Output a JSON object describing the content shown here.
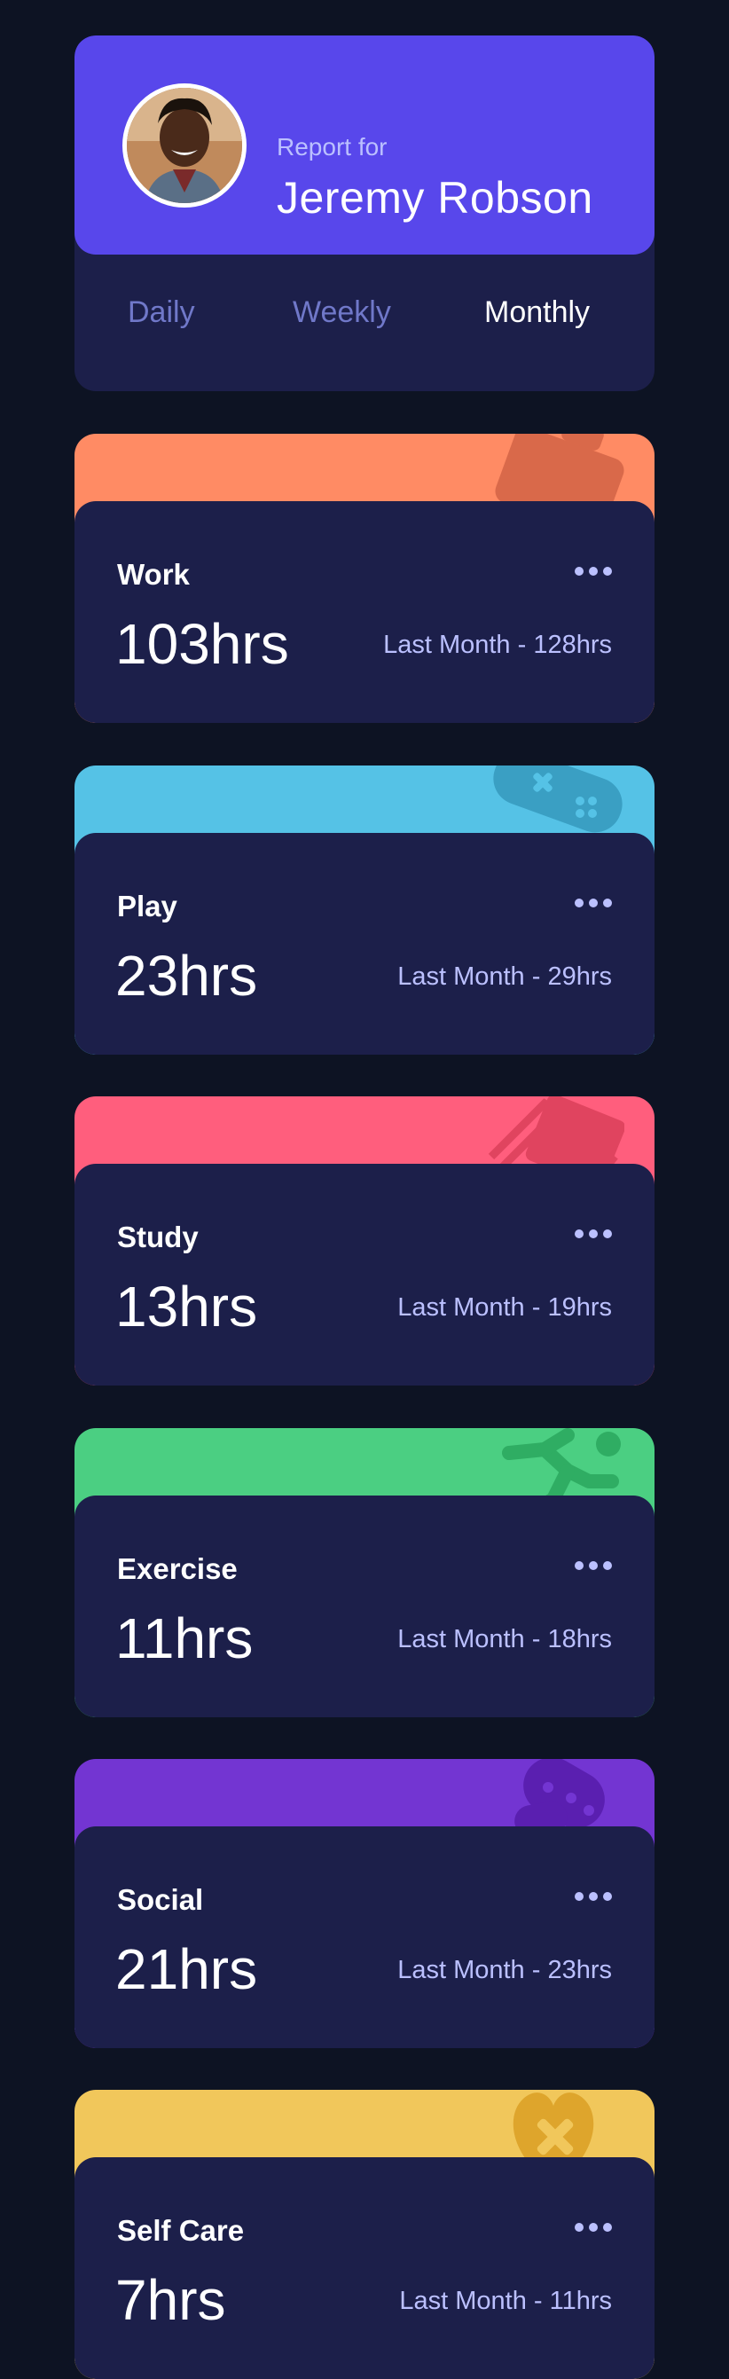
{
  "profile": {
    "report_for": "Report for",
    "name": "Jeremy Robson"
  },
  "tabs": [
    {
      "label": "Daily",
      "active": false
    },
    {
      "label": "Weekly",
      "active": false
    },
    {
      "label": "Monthly",
      "active": true
    }
  ],
  "activities": [
    {
      "title": "Work",
      "hours": "103hrs",
      "previous": "Last Month - 128hrs",
      "color": "#ff8b64",
      "icon": "briefcase-icon"
    },
    {
      "title": "Play",
      "hours": "23hrs",
      "previous": "Last Month - 29hrs",
      "color": "#55c2e6",
      "icon": "gamepad-icon"
    },
    {
      "title": "Study",
      "hours": "13hrs",
      "previous": "Last Month - 19hrs",
      "color": "#ff5e7d",
      "icon": "books-icon"
    },
    {
      "title": "Exercise",
      "hours": "11hrs",
      "previous": "Last Month - 18hrs",
      "color": "#4bcf82",
      "icon": "running-icon"
    },
    {
      "title": "Social",
      "hours": "21hrs",
      "previous": "Last Month - 23hrs",
      "color": "#7335d2",
      "icon": "social-icon"
    },
    {
      "title": "Self Care",
      "hours": "7hrs",
      "previous": "Last Month - 11hrs",
      "color": "#f1c75b",
      "icon": "heart-icon"
    }
  ],
  "colors": {
    "background": "#0d1323",
    "card": "#1c1f4a",
    "accent": "#5847eb",
    "muted_text": "#bbc0ff"
  }
}
